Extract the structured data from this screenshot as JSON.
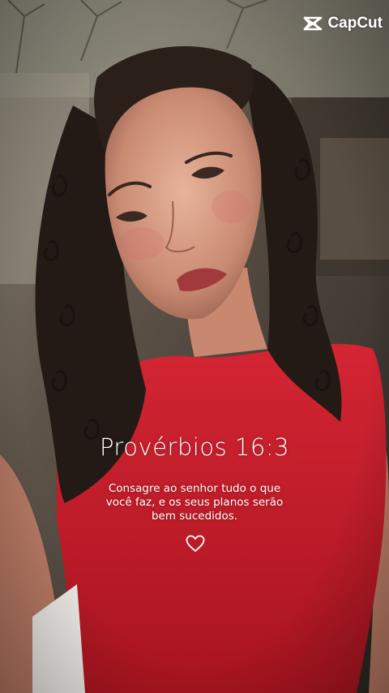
{
  "watermark": {
    "brand": "CapCut",
    "icon": "capcut-logo-icon"
  },
  "verse": {
    "reference": "Provérbios 16:3",
    "line1": "Consagre ao senhor tudo o que",
    "line2": "você faz, e os seus planos serão",
    "line3": "bem sucedidos.",
    "icon": "heart-outline-icon"
  },
  "colors": {
    "shirt": "#c81d2b",
    "text": "#ffffff"
  }
}
